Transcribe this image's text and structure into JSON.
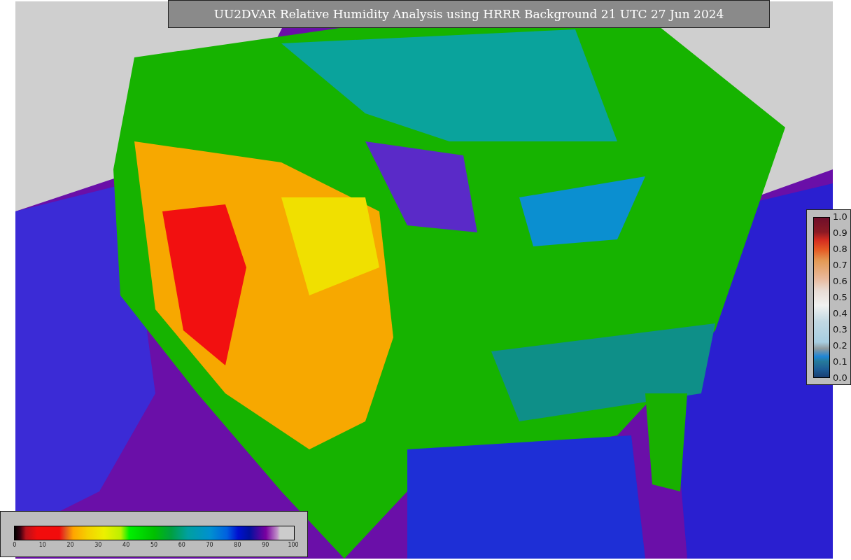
{
  "title": "UU2DVAR Relative Humidity Analysis using HRRR Background 21 UTC 27 Jun 2024",
  "observation_legend": {
    "ticks": [
      "1.0",
      "0.9",
      "0.8",
      "0.7",
      "0.6",
      "0.5",
      "0.4",
      "0.3",
      "0.2",
      "0.1",
      "0.0"
    ]
  },
  "humidity_legend": {
    "ticks": [
      "0",
      "10",
      "20",
      "30",
      "40",
      "50",
      "60",
      "70",
      "80",
      "90",
      "100"
    ]
  }
}
